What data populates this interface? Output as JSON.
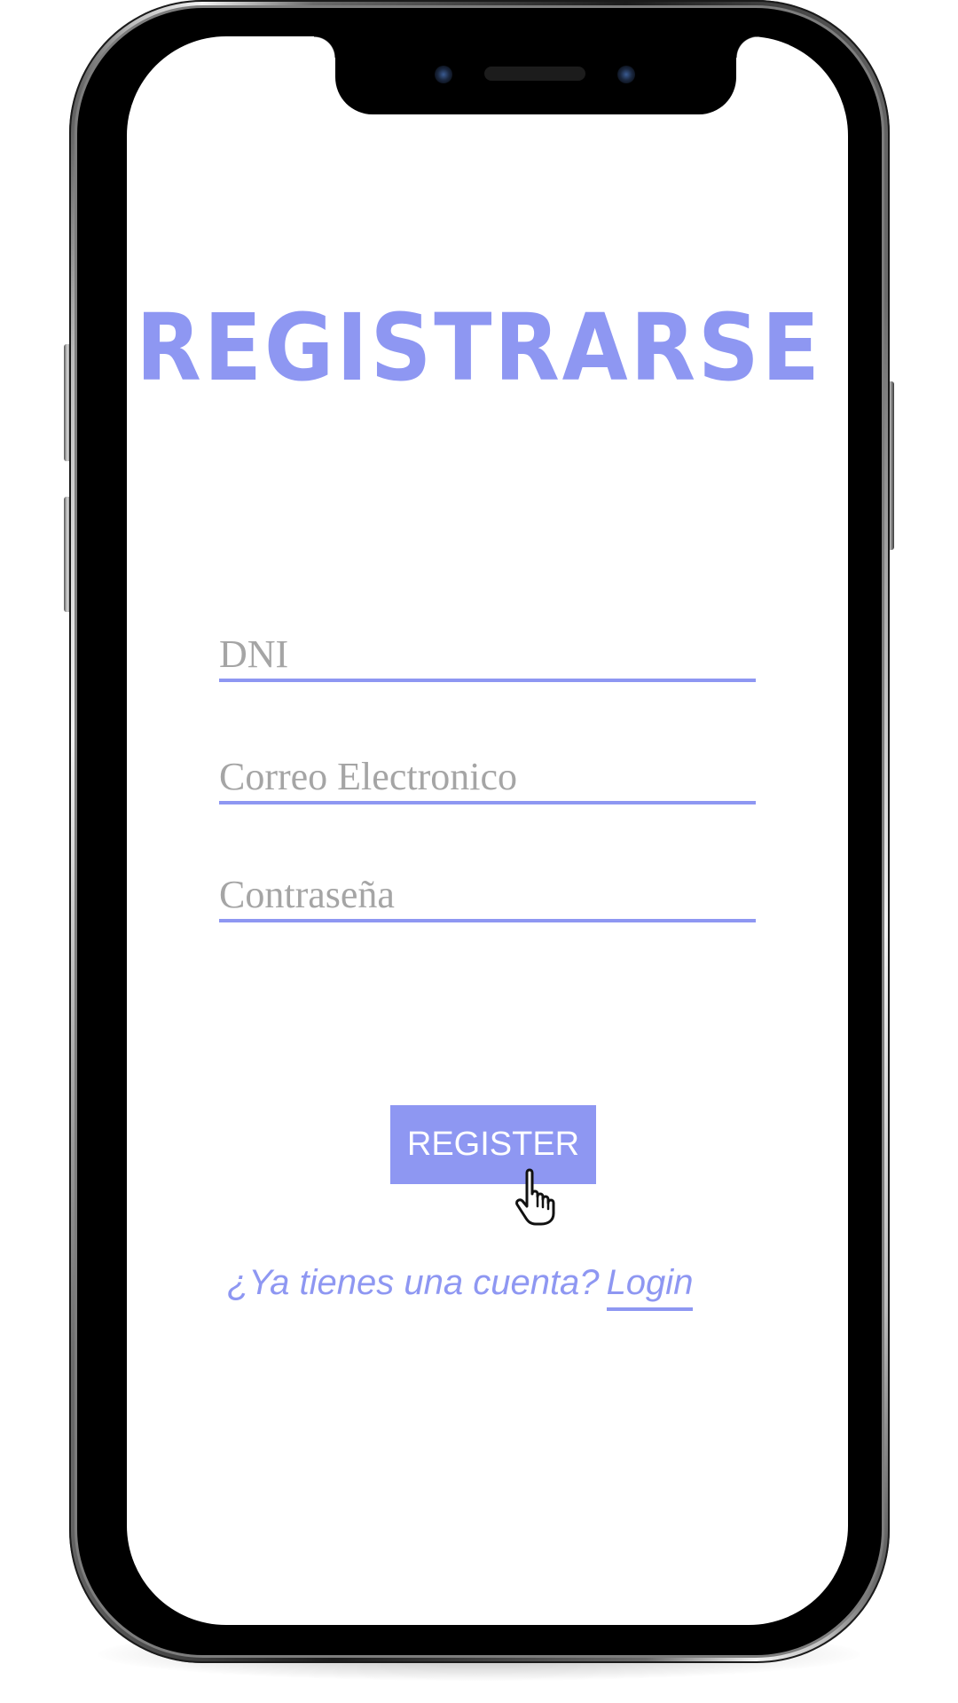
{
  "screen": {
    "title": "REGISTRARSE",
    "fields": {
      "dni_placeholder": "DNI",
      "email_placeholder": "Correo Electronico",
      "password_placeholder": "Contraseña"
    },
    "register_button_label": "REGISTER",
    "login_prompt": "¿Ya tienes una cuenta?",
    "login_link_label": "Login"
  },
  "icons": {
    "cursor": "hand-pointer-icon"
  },
  "colors": {
    "accent": "#8e97f2",
    "placeholder_text": "#a5a5a5",
    "button_text": "#ffffff",
    "screen_background": "#ffffff"
  }
}
